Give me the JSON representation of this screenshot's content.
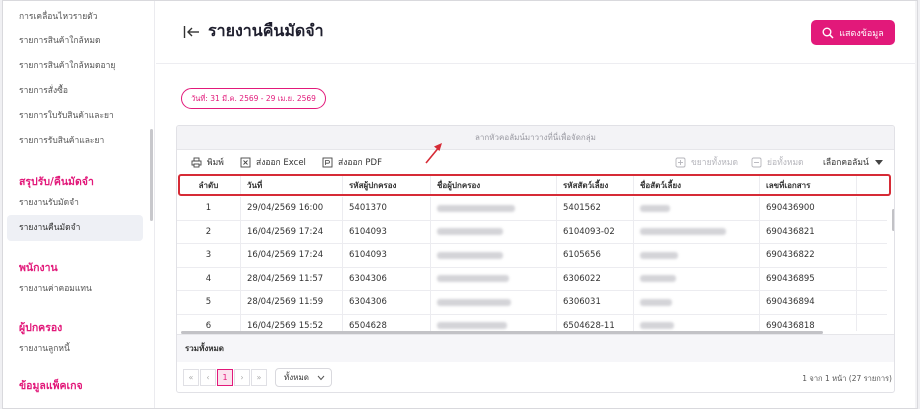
{
  "sidebar": {
    "items": [
      {
        "label": "การเคลื่อนไหวรายตัว",
        "active": false
      },
      {
        "label": "รายการสินค้าใกล้หมด",
        "active": false
      },
      {
        "label": "รายการสินค้าใกล้หมดอายุ",
        "active": false
      },
      {
        "label": "รายการสั่งซื้อ",
        "active": false
      },
      {
        "label": "รายการใบรับสินค้าและยา",
        "active": false
      },
      {
        "label": "รายการรับสินค้าและยา",
        "active": false
      }
    ],
    "section_return": {
      "title": "สรุปรับ/คืนมัดจำ",
      "items": [
        {
          "label": "รายงานรับมัดจำ",
          "active": false
        },
        {
          "label": "รายงานคืนมัดจำ",
          "active": true
        }
      ]
    },
    "section_staff": {
      "title": "พนักงาน",
      "items": [
        {
          "label": "รายงานค่าคอมแทน",
          "active": false
        }
      ]
    },
    "section_owner": {
      "title": "ผู้ปกครอง",
      "items": [
        {
          "label": "รายงานลูกหนี้",
          "active": false
        }
      ]
    },
    "section_package": {
      "title": "ข้อมูลแพ็คเกจ"
    }
  },
  "header": {
    "title": "รายงานคืนมัดจำ",
    "show_button": "แสดงข้อมูล"
  },
  "date_range": "วันที่: 31 มี.ค. 2569 - 29 เม.ย. 2569",
  "grid": {
    "group_hint": "ลากหัวคอลัมน์มาวางที่นี่เพื่อจัดกลุ่ม",
    "toolbar": {
      "print": "พิมพ์",
      "export_excel": "ส่งออก Excel",
      "export_pdf": "ส่งออก PDF",
      "expand_all": "ขยายทั้งหมด",
      "collapse_all": "ย่อทั้งหมด",
      "choose_columns": "เลือกคอลัมน์"
    },
    "columns": [
      "ลำดับ",
      "วันที่",
      "รหัสผู้ปกครอง",
      "ชื่อผู้ปกครอง",
      "รหัสสัตว์เลี้ยง",
      "ชื่อสัตว์เลี้ยง",
      "เลขที่เอกสาร"
    ],
    "rows": [
      {
        "no": "1",
        "date": "29/04/2569 16:00",
        "owner_code": "5401370",
        "pet_code": "5401562",
        "doc_no": "690436900"
      },
      {
        "no": "2",
        "date": "16/04/2569 17:24",
        "owner_code": "6104093",
        "pet_code": "6104093-02",
        "doc_no": "690436821"
      },
      {
        "no": "3",
        "date": "16/04/2569 17:24",
        "owner_code": "6104093",
        "pet_code": "6105656",
        "doc_no": "690436822"
      },
      {
        "no": "4",
        "date": "28/04/2569 11:57",
        "owner_code": "6304306",
        "pet_code": "6306022",
        "doc_no": "690436895"
      },
      {
        "no": "5",
        "date": "28/04/2569 11:59",
        "owner_code": "6304306",
        "pet_code": "6306031",
        "doc_no": "690436894"
      },
      {
        "no": "6",
        "date": "16/04/2569 15:52",
        "owner_code": "6504628",
        "pet_code": "6504628-11",
        "doc_no": "690436818"
      }
    ],
    "total_label": "รวมทั้งหมด",
    "pager": {
      "first": "«",
      "prev": "‹",
      "current_page": "1",
      "next": "›",
      "last": "»",
      "page_size": "ทั้งหมด",
      "info": "1 จาก 1 หน้า (27 รายการ)"
    }
  },
  "colors": {
    "accent": "#e2197a",
    "highlight": "#d62b36"
  }
}
